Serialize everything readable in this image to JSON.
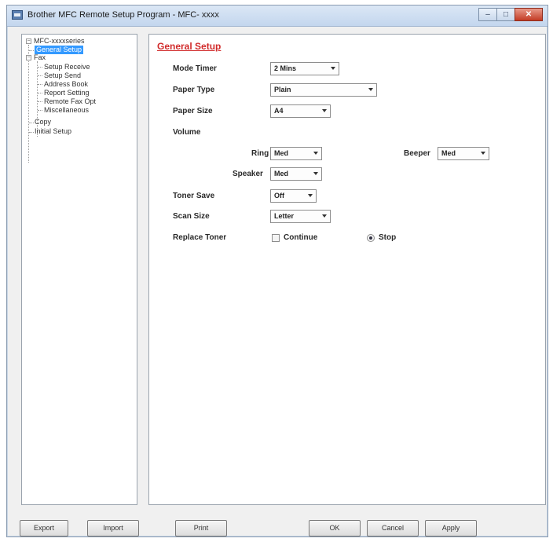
{
  "window": {
    "title": "Brother MFC Remote Setup Program - MFC- xxxx",
    "controls": {
      "minimize": "–",
      "maximize": "□",
      "close": "✕"
    }
  },
  "tree": {
    "root": "MFC-xxxxseries",
    "general_setup": "General Setup",
    "fax": "Fax",
    "fax_children": [
      "Setup Receive",
      "Setup Send",
      "Address Book",
      "Report Setting",
      "Remote Fax Opt",
      "Miscellaneous"
    ],
    "copy": "Copy",
    "initial_setup": "Initial Setup"
  },
  "panel": {
    "heading": "General Setup",
    "mode_timer": {
      "label": "Mode Timer",
      "value": "2 Mins"
    },
    "paper_type": {
      "label": "Paper Type",
      "value": "Plain"
    },
    "paper_size": {
      "label": "Paper Size",
      "value": "A4"
    },
    "volume": {
      "label": "Volume",
      "ring": {
        "label": "Ring",
        "value": "Med"
      },
      "beeper": {
        "label": "Beeper",
        "value": "Med"
      },
      "speaker": {
        "label": "Speaker",
        "value": "Med"
      }
    },
    "toner_save": {
      "label": "Toner Save",
      "value": "Off"
    },
    "scan_size": {
      "label": "Scan Size",
      "value": "Letter"
    },
    "replace_toner": {
      "label": "Replace Toner",
      "continue_label": "Continue",
      "stop_label": "Stop",
      "selected": "Stop"
    }
  },
  "buttons": {
    "export": "Export",
    "import": "Import",
    "print": "Print",
    "ok": "OK",
    "cancel": "Cancel",
    "apply": "Apply"
  }
}
